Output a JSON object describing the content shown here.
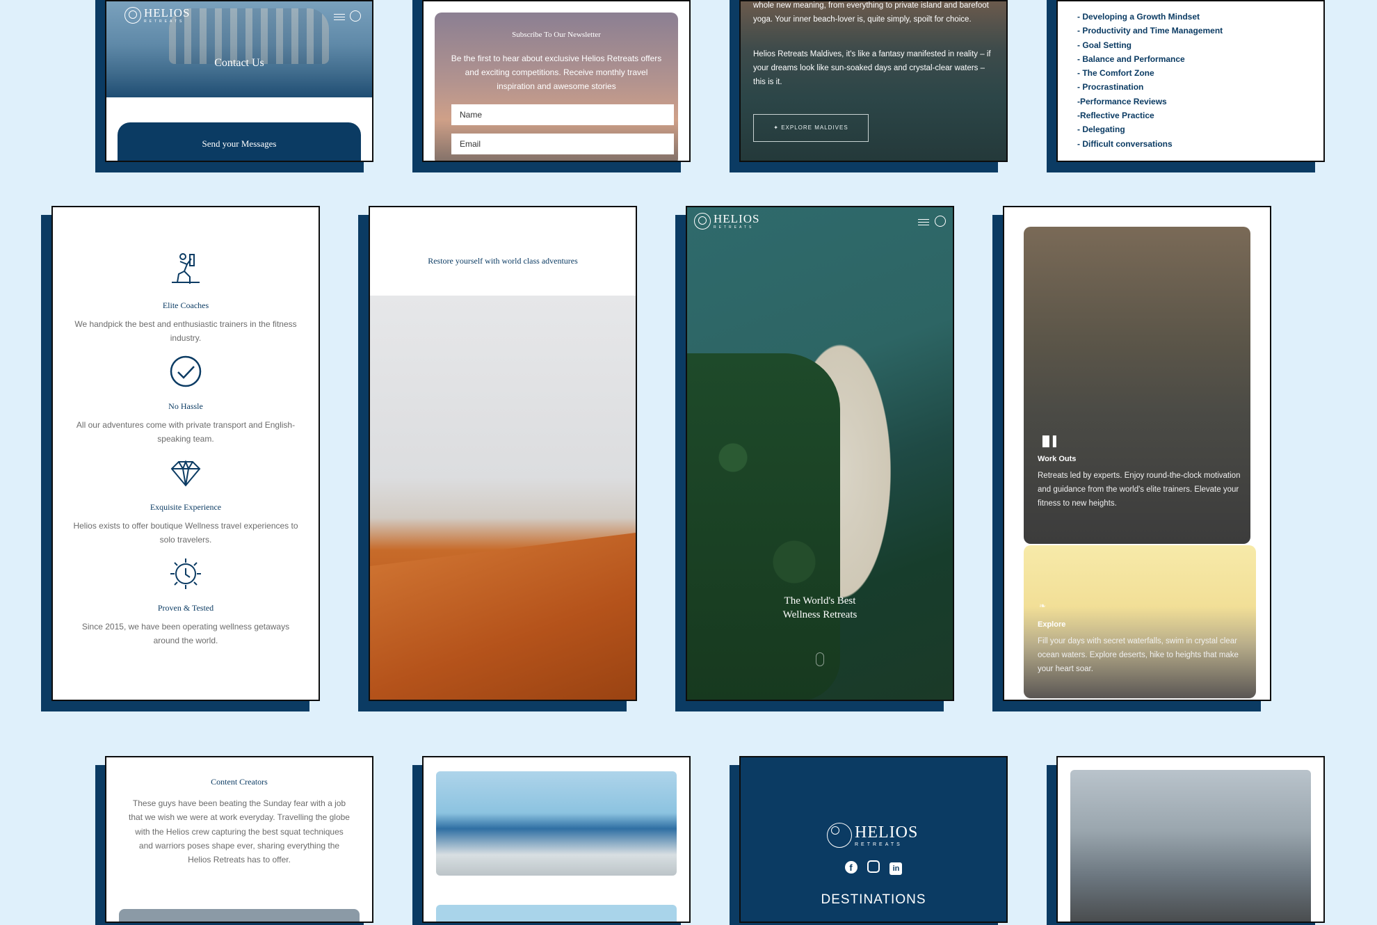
{
  "colors": {
    "background": "#dff0fb",
    "navy": "#0b3b63",
    "text_gray": "#6b6b6b"
  },
  "brand": {
    "name": "HELIOS",
    "tagline": "RETREATS"
  },
  "contact_card": {
    "heading": "Contact Us",
    "button": "Send your Messages"
  },
  "newsletter_card": {
    "title": "Subscribe To Our Newsletter",
    "text": "Be the first to hear about exclusive Helios Retreats offers and exciting competitions. Receive monthly travel inspiration and awesome stories",
    "name_placeholder": "Name",
    "email_placeholder": "Email"
  },
  "maldives_card": {
    "para1": "whole new meaning, from everything to private island and barefoot yoga. Your inner beach-lover is, quite simply, spoilt for choice.",
    "para2": "Helios Retreats Maldives, it's like a fantasy manifested in reality – if your dreams look like sun-soaked days and crystal-clear waters – this is it.",
    "button": "EXPLORE MALDIVES"
  },
  "topics_card": {
    "items": [
      "- Developing a Growth Mindset",
      "- Productivity and Time Management",
      "- Goal Setting",
      "- Balance and Performance",
      "- The Comfort Zone",
      "- Procrastination",
      "-Performance Reviews",
      "-Reflective Practice",
      "- Delegating",
      "- Difficult conversations"
    ]
  },
  "features_card": {
    "items": [
      {
        "icon": "climber-icon",
        "title": "Elite Coaches",
        "text": "We handpick the best and enthusiastic trainers in the fitness industry."
      },
      {
        "icon": "checkmark-icon",
        "title": "No Hassle",
        "text": "All our adventures come with private transport and English-speaking team."
      },
      {
        "icon": "diamond-icon",
        "title": "Exquisite Experience",
        "text": "Helios exists to offer boutique Wellness travel experiences to solo travelers."
      },
      {
        "icon": "clock-sun-icon",
        "title": "Proven & Tested",
        "text": "Since 2015, we have been operating wellness getaways around the world."
      }
    ]
  },
  "desert_card": {
    "heading": "Restore yourself with world class adventures"
  },
  "hero_card": {
    "line1": "The World's Best",
    "line2": "Wellness Retreats"
  },
  "activities_card": {
    "workouts": {
      "icon": "dumbbell-icon",
      "title": "Work Outs",
      "text": "Retreats led by experts. Enjoy round-the-clock motivation and guidance from the world's elite trainers. Elevate your fitness to new heights."
    },
    "explore": {
      "icon": "leaf-icon",
      "title": "Explore",
      "text": "Fill your days with secret waterfalls, swim in crystal clear ocean waters. Explore deserts, hike to heights that make your heart soar."
    }
  },
  "creators_card": {
    "title": "Content Creators",
    "text": "These guys have been beating the Sunday fear with a job that we wish we were at work everyday. Travelling the globe with the Helios crew capturing the best squat techniques and warriors poses shape ever, sharing everything the Helios Retreats has to offer."
  },
  "footer_card": {
    "social": [
      "facebook-icon",
      "instagram-icon",
      "linkedin-icon"
    ],
    "heading": "DESTINATIONS"
  }
}
